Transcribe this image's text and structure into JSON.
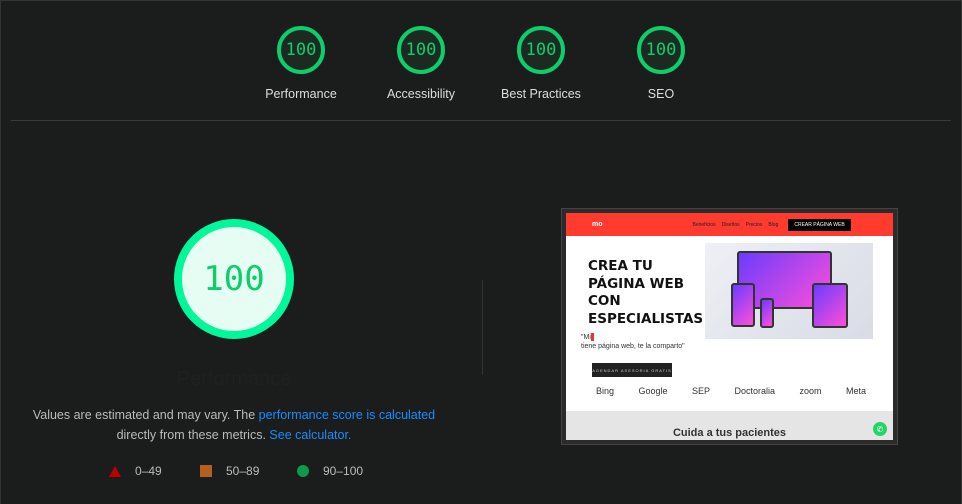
{
  "summary": [
    {
      "label": "Performance",
      "score": "100"
    },
    {
      "label": "Accessibility",
      "score": "100"
    },
    {
      "label": "Best Practices",
      "score": "100"
    },
    {
      "label": "SEO",
      "score": "100"
    }
  ],
  "main": {
    "score": "100",
    "title": "Performance",
    "desc_prefix": "Values are estimated and may vary. The ",
    "desc_link1": "performance score is calculated",
    "desc_mid": " directly from these metrics. ",
    "desc_link2": "See calculator."
  },
  "legend": [
    {
      "label": "0–49",
      "color": "#c00000",
      "shape": "triangle"
    },
    {
      "label": "50–89",
      "color": "#b4601c",
      "shape": "square"
    },
    {
      "label": "90–100",
      "color": "#0b9b4a",
      "shape": "circle"
    }
  ],
  "screenshot": {
    "logo": "mo",
    "nav": [
      "Beneficios",
      "Diseños",
      "Precios",
      "Blog"
    ],
    "cta": "CREAR PÁGINA WEB",
    "hero": [
      "CREA TU",
      "PÁGINA WEB",
      "CON",
      "ESPECIALISTAS"
    ],
    "quote1": "\"Mi",
    "quote2": "tiene página web, te la comparto\"",
    "button": "AGENDAR ASESORIA GRATIS",
    "logos": [
      "Bing",
      "Google",
      "SEP",
      "Doctoralia",
      "zoom",
      "Meta"
    ],
    "section": "Cuida a tus pacientes"
  },
  "colors": {
    "pass": "#0cce6b",
    "link": "#1a8cff"
  }
}
